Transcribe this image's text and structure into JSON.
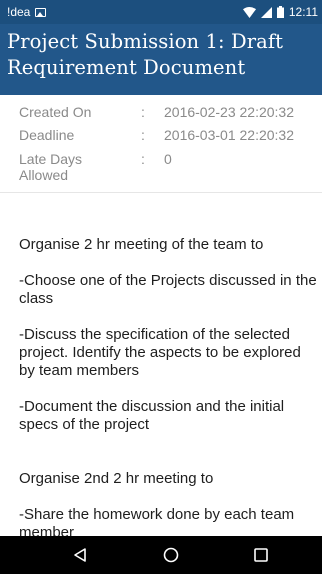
{
  "status_bar": {
    "app_name": "!dea",
    "time": "12:11",
    "icons": [
      "image-notification-icon",
      "wifi-icon",
      "signal-icon",
      "battery-icon"
    ]
  },
  "header": {
    "title": "Project Submission 1: Draft Requirement Document"
  },
  "meta": {
    "rows": [
      {
        "label": "Created On",
        "colon": ":",
        "value": "2016-02-23 22:20:32"
      },
      {
        "label": "Deadline",
        "colon": ":",
        "value": "2016-03-01 22:20:32"
      },
      {
        "label": "Late Days Allowed",
        "colon": ":",
        "value": "0"
      }
    ]
  },
  "content": {
    "paragraphs": [
      "Organise 2 hr meeting of the team to",
      "-Choose one of the Projects discussed in the class",
      "-Discuss the specification of the selected project. Identify the aspects to be explored by team members",
      "-Document the discussion and the initial specs of the project",
      "Organise 2nd 2 hr meeting  to",
      "-Share the homework done by each team member"
    ]
  },
  "nav_bar": {
    "buttons": [
      "back-icon",
      "home-icon",
      "recents-icon"
    ]
  },
  "colors": {
    "status_bar": "#1c4f7e",
    "header": "#22578a",
    "meta_text": "#8a8a8a",
    "body_text": "#1e1e1e",
    "nav_bar": "#000000"
  }
}
